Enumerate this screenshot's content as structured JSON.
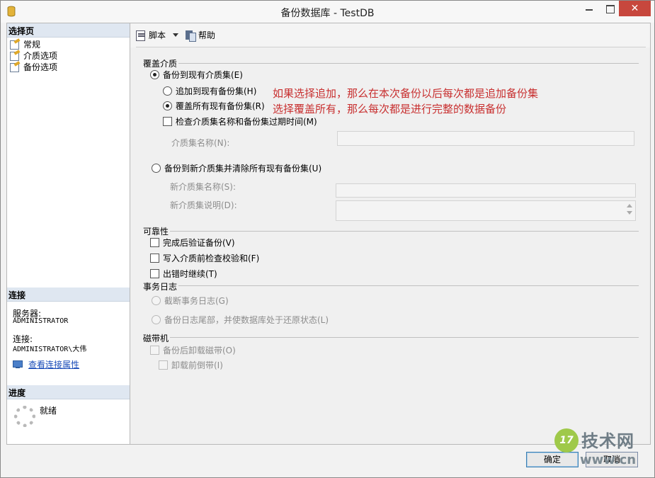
{
  "window": {
    "title": "备份数据库 - TestDB",
    "close_glyph": "✕"
  },
  "left": {
    "select_page_header": "选择页",
    "pages": [
      {
        "label": "常规",
        "icon": "page-icon"
      },
      {
        "label": "介质选项",
        "icon": "page-icon"
      },
      {
        "label": "备份选项",
        "icon": "page-icon"
      }
    ],
    "connection_header": "连接",
    "server_label": "服务器:",
    "server_value": "ADMINISTRATOR",
    "connection_label": "连接:",
    "connection_value": "ADMINISTRATOR\\大伟",
    "view_connection_link": "查看连接属性",
    "progress_header": "进度",
    "progress_status": "就绪"
  },
  "toolbar": {
    "script_label": "脚本",
    "help_label": "帮助"
  },
  "overwrite_media": {
    "group_label": "覆盖介质",
    "backup_existing": {
      "label": "备份到现有介质集(E)",
      "checked": true
    },
    "append": {
      "label": "追加到现有备份集(H)",
      "checked": false
    },
    "overwrite": {
      "label": "覆盖所有现有备份集(R)",
      "checked": true
    },
    "check_media_name": {
      "label": "检查介质集名称和备份集过期时间(M)",
      "checked": false
    },
    "media_name_label": "介质集名称(N):",
    "media_name_value": "",
    "backup_new": {
      "label": "备份到新介质集并清除所有现有备份集(U)",
      "checked": false
    },
    "new_media_name_label": "新介质集名称(S):",
    "new_media_name_value": "",
    "new_media_desc_label": "新介质集说明(D):",
    "new_media_desc_value": ""
  },
  "annotation": {
    "line1": "如果选择追加，那么在本次备份以后每次都是追加备份集",
    "line2": "选择覆盖所有，那么每次都是进行完整的数据备份",
    "color": "#c83030"
  },
  "reliability": {
    "group_label": "可靠性",
    "verify": {
      "label": "完成后验证备份(V)",
      "checked": false
    },
    "checksum": {
      "label": "写入介质前检查校验和(F)",
      "checked": false
    },
    "continue_on_error": {
      "label": "出错时继续(T)",
      "checked": false
    }
  },
  "transaction_log": {
    "group_label": "事务日志",
    "truncate": {
      "label": "截断事务日志(G)",
      "checked": false
    },
    "tail": {
      "label": "备份日志尾部，并使数据库处于还原状态(L)",
      "checked": false
    }
  },
  "tape": {
    "group_label": "磁带机",
    "unload": {
      "label": "备份后卸载磁带(O)",
      "checked": false
    },
    "rewind": {
      "label": "卸载前倒带(I)",
      "checked": false
    }
  },
  "buttons": {
    "ok": "确定",
    "cancel": "取消"
  },
  "watermark": {
    "logo": "17",
    "name": "技术网",
    "url": "www.cn"
  }
}
